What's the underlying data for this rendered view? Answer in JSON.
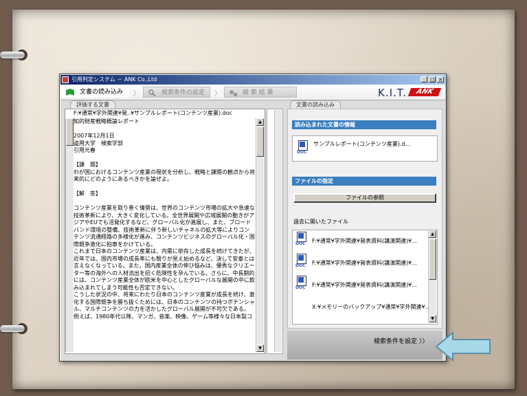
{
  "window": {
    "title": "引用判定システム － ANK Co.,Ltd"
  },
  "steps": {
    "load": "文書の読み込み",
    "search_cond": "検索条件の設定",
    "results": "検 索 結 果"
  },
  "brand": {
    "kit": "K.I.T.",
    "ank": "ANK"
  },
  "left": {
    "tab": "評価する文書",
    "filepath": "F:¥通常¥学外関連¥発..¥サンプルレポート(コンテンツ産業).doc",
    "text": "知的財産戦略概論レポート\n\n2007年12月1日\n盗用大学　検索学部\n引用元春\n\n【課　題】\nわが国におけるコンテンツ産業の現状を分析し、戦略と課題の観点から将来的にどのようにあるべきかを論ぜよ。\n\n【解　答】\n\nコンテンツ産業を取り巻く情勢は、世界のコンテンツ市場の拡大や急速な技術革新により、大きく変化している。全世界展開や広域展開の動きがアジアやEUでも活発化するなど、グローバル化が進展し、また、ブロードバンド環境の整備、技術革新に伴う新しいチャネルの拡大等によりコンテンツ流通経路の多様化が進み、コンテンツビジネスのグローバル化・国際競争激化に拍車をかけている。\nこれまで日本のコンテンツ産業は、内需に依存した成長を続けてきたが、近年では、国内市場の成長率にも翳りが見え始めるなど、決して安泰とは言えなくなっている。また、国内産業全体の伸び悩みは、優秀なクリエーター等の海外への人材流出を招く危険性を孕んでいる。さらに、中長期的には、コンテンツ産業全体が欧米を中心としたグローバルな展開の中に飲み込まれてしまう可能性も否定できない。\nこうした状況の中、将来にわたり日本のコンテンツ産業が成長を続け、激化する国際競争を勝ち抜くためには、日本のコンテンツの持つポテンシャル、マルチコンテンツの力を活かしたグローバル展開が不可欠である。\n例えば、1980年代以降、マンガ、音楽、映像、ゲーム等様々な日本製コ"
  },
  "right": {
    "tab": "文書の読み込み",
    "info_header": "読み込まれた文書の情報",
    "loaded_file": "サンプルレポート(コンテンツ産業).d...",
    "file_header": "ファイルの指定",
    "browse_button": "ファイルの参照",
    "history_label": "過去に開いたファイル",
    "history": [
      "F:¥通常¥学外関連¥発表資料(講演関連)¥...",
      "F:¥通常¥学外関連¥発表資料(講演関連)¥...",
      "F:¥通常¥学外関連¥発表資料(講演関連)¥...",
      "X:¥メモリーのバックアップ¥通常¥学外関連¥..."
    ],
    "icon_label": "DOC"
  },
  "footer": {
    "next_button": "検索条件を設定 〉〉"
  },
  "colors": {
    "section_header": "#3a7fbf",
    "titlebar": "#0a246a",
    "accent_arrow": "#a8d8e8"
  }
}
